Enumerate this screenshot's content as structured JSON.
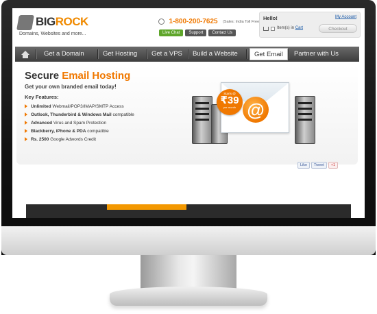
{
  "brand": {
    "logo_big": "BIG",
    "logo_rock": "ROCK",
    "tagline": "Domains, Websites and more..."
  },
  "header": {
    "phone": "1-800-200-7625",
    "phone_note": "(Sales: India Toll Free)",
    "buttons": {
      "live_chat": "Live Chat",
      "support": "Support",
      "contact_us": "Contact Us"
    }
  },
  "account": {
    "greeting": "Hello!",
    "my_account": "My Account",
    "cart_text": "Item(s) in",
    "cart_link": "Cart",
    "checkout": "Checkout"
  },
  "nav": {
    "items": [
      {
        "label": "Get a Domain"
      },
      {
        "label": "Get Hosting"
      },
      {
        "label": "Get a VPS"
      },
      {
        "label": "Build a Website"
      },
      {
        "label": "Get Email"
      },
      {
        "label": "Partner with Us"
      }
    ],
    "active_index": 4
  },
  "hero": {
    "title_prefix": "Secure",
    "title_accent": "Email Hosting",
    "subtitle": "Get your own branded email today!",
    "key_features_title": "Key Features:",
    "features": [
      {
        "bold": "Unlimited",
        "text": "Webmail/POP3/IMAP/SMTP Access"
      },
      {
        "bold": "Outlook, Thunderbird & Windows Mail",
        "text": "compatible"
      },
      {
        "bold": "Advanced",
        "text": "Virus and Spam Protection"
      },
      {
        "bold": "Blackberry, iPhone & PDA",
        "text": "compatible"
      },
      {
        "bold": "Rs. 2500",
        "text": "Google Adwords Credit"
      }
    ],
    "price_badge": {
      "top": "Starts @",
      "amount": "₹39",
      "bottom": "per month"
    },
    "envelope_symbol": "@"
  },
  "social": {
    "like": "Like",
    "tweet": "Tweet",
    "plus_one": "+1"
  },
  "colors": {
    "accent": "#f07800",
    "nav_bg": "#4a4a4a",
    "green": "#5ea52a"
  }
}
